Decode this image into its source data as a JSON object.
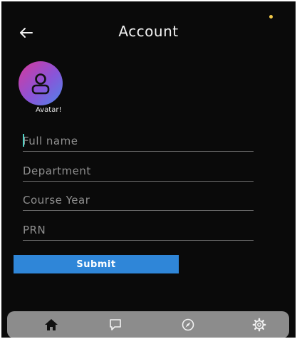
{
  "header": {
    "title": "Account",
    "back_icon": "back-arrow-icon"
  },
  "avatar": {
    "icon": "user-icon",
    "label": "Avatar!"
  },
  "form": {
    "fields": [
      {
        "placeholder": "Full name",
        "value": ""
      },
      {
        "placeholder": "Department",
        "value": ""
      },
      {
        "placeholder": "Course Year",
        "value": ""
      },
      {
        "placeholder": "PRN",
        "value": ""
      }
    ],
    "submit_label": "Submit"
  },
  "bottom_nav": {
    "items": [
      {
        "icon": "home-icon"
      },
      {
        "icon": "chat-icon"
      },
      {
        "icon": "compass-icon"
      },
      {
        "icon": "gear-icon"
      }
    ]
  },
  "colors": {
    "background": "#0a0a0a",
    "accent": "#2f86d8",
    "nav_bar": "#8c8c8c",
    "avatar_gradient": [
      "#d6399b",
      "#8a54d8",
      "#4d86e8"
    ],
    "status_dot": "#f3c94a",
    "cursor": "#4fd0c4"
  }
}
